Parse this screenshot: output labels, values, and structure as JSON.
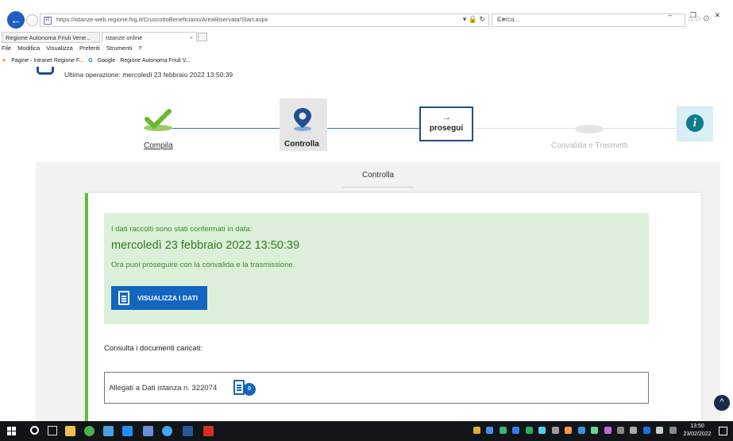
{
  "browser": {
    "url": "https://istanze-web.regione.fvg.it/CruscottoBeneficiario/AreaRiservata/Start.aspx",
    "search_placeholder": "Cerca...",
    "tabs": [
      {
        "label": "Regione Autonoma Friuli Vene..."
      },
      {
        "label": "Istanze online",
        "close": "×"
      }
    ],
    "menu": [
      "File",
      "Modifica",
      "Visualizza",
      "Preferiti",
      "Strumenti",
      "?"
    ],
    "favorites": [
      "Pagine - Intranet Regione F...",
      "Google",
      "Regione Autonoma Friuli V..."
    ],
    "window_controls": "–  ❐  ✕"
  },
  "page": {
    "last_operation": "Ultima operazione: mercoledì 23 febbraio 2022 13:50:39",
    "steps": {
      "compila": "Compila",
      "controlla": "Controlla",
      "prosegui": "prosegui",
      "prosegui_arrow": "→",
      "convalida": "Convalida e Trasmetti"
    },
    "info_glyph": "i",
    "panel_title": "Controlla",
    "success": {
      "line1": "I dati raccolti sono stati confermati in data:",
      "date": "mercoledì 23 febbraio 2022 13:50:39",
      "line3": "Ora puoi proseguire con la convalida e la trasmissione.",
      "button": "VISUALIZZA I DATI"
    },
    "documents": {
      "heading": "Consulta i documenti caricati:",
      "allegati": "Allegati a Dati istanza n. 322074",
      "count": "0"
    },
    "scroll_top_glyph": "^"
  },
  "taskbar": {
    "time": "13:50",
    "date": "23/02/2022"
  },
  "colors": {
    "brand_blue": "#1366c0",
    "success_green": "#66bb33",
    "success_bg": "#dcefd8",
    "info_teal": "#0d7d8e"
  }
}
